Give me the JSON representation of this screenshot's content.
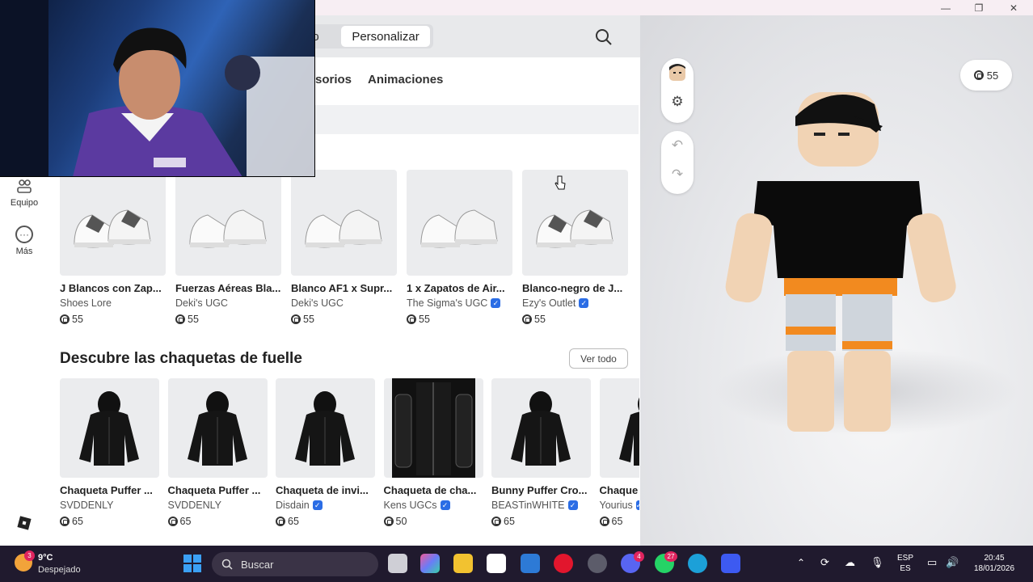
{
  "window": {
    "minimize_icon": "minimize-icon",
    "maximize_icon": "restore-icon",
    "close_icon": "close-icon"
  },
  "header": {
    "segment_left": "do",
    "segment_right": "Personalizar",
    "search_icon": "search-icon"
  },
  "sidebar": {
    "items": [
      {
        "label": "Equipo",
        "icon": "group-icon"
      },
      {
        "label": "Más",
        "icon": "more-icon"
      }
    ],
    "logo_icon": "roblox-logo-icon"
  },
  "tabs": [
    "sorios",
    "Animaciones"
  ],
  "row1": [
    {
      "name": "J Blancos con Zap...",
      "creator": "Shoes Lore",
      "verified": false,
      "price": "55"
    },
    {
      "name": "Fuerzas Aéreas Bla...",
      "creator": "Deki's UGC",
      "verified": false,
      "price": "55"
    },
    {
      "name": "Blanco AF1 x Supr...",
      "creator": "Deki's UGC",
      "verified": false,
      "price": "55"
    },
    {
      "name": "1 x Zapatos de Air...",
      "creator": "The Sigma's UGC",
      "verified": true,
      "price": "55"
    },
    {
      "name": "Blanco-negro de J...",
      "creator": "Ezy's Outlet",
      "verified": true,
      "price": "55"
    }
  ],
  "section2": {
    "title": "Descubre las chaquetas de fuelle",
    "see_all": "Ver todo"
  },
  "row2": [
    {
      "name": "Chaqueta Puffer ...",
      "creator": "SVDDENLY",
      "verified": false,
      "price": "65"
    },
    {
      "name": "Chaqueta Puffer ...",
      "creator": "SVDDENLY",
      "verified": false,
      "price": "65"
    },
    {
      "name": "Chaqueta de invi...",
      "creator": "Disdain",
      "verified": true,
      "price": "65"
    },
    {
      "name": "Chaqueta de cha...",
      "creator": "Kens UGCs",
      "verified": true,
      "price": "50"
    },
    {
      "name": "Bunny Puffer Cro...",
      "creator": "BEASTinWHITE",
      "verified": true,
      "price": "65"
    },
    {
      "name": "Chaque",
      "creator": "Yourius",
      "verified": true,
      "price": "65"
    }
  ],
  "preview": {
    "price": "55",
    "buttons": [
      "avatar-head-icon",
      "settings-icon",
      "undo-icon",
      "redo-icon"
    ]
  },
  "taskbar": {
    "weather_temp": "9°C",
    "weather_desc": "Despejado",
    "weather_badge": "3",
    "search_placeholder": "Buscar",
    "lang_top": "ESP",
    "lang_bottom": "ES",
    "time": "20:45",
    "date": "18/01/2026",
    "discord_badge": "4",
    "whatsapp_badge": "27"
  },
  "colors": {
    "accent": "#2b6de5",
    "taskbar": "#201a2e",
    "background": "#f2f3f5"
  }
}
